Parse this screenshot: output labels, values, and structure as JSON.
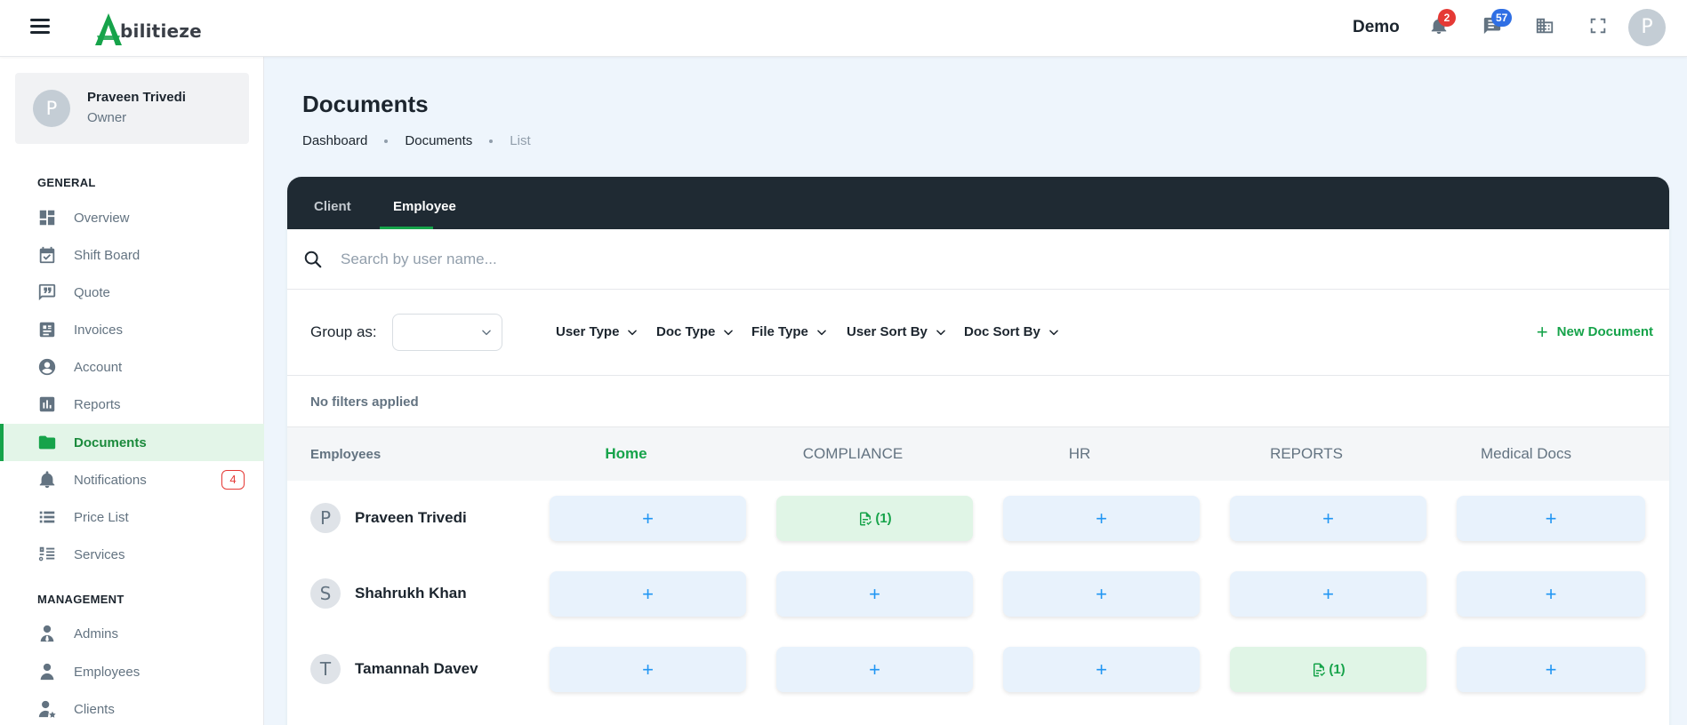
{
  "app": {
    "logo_letter": "A",
    "logo_text": "bilitieze",
    "company": "Demo",
    "notifications_count": "2",
    "messages_count": "57",
    "user_initial": "P",
    "colors": {
      "brand": "#16a34a",
      "notif_badge": "#e53935",
      "msg_badge": "#2f6fe4",
      "dark_tabbar": "#1f2a33"
    }
  },
  "sidebar": {
    "profile": {
      "initial": "P",
      "name": "Praveen Trivedi",
      "role": "Owner"
    },
    "general_title": "GENERAL",
    "general_items": [
      {
        "label": "Overview",
        "icon": "dashboard-icon"
      },
      {
        "label": "Shift Board",
        "icon": "calendar-check-icon"
      },
      {
        "label": "Quote",
        "icon": "quote-icon"
      },
      {
        "label": "Invoices",
        "icon": "invoice-icon"
      },
      {
        "label": "Account",
        "icon": "account-circle-icon"
      },
      {
        "label": "Reports",
        "icon": "bar-chart-icon"
      },
      {
        "label": "Documents",
        "icon": "folder-icon",
        "active": true
      },
      {
        "label": "Notifications",
        "icon": "bell-icon",
        "badge": "4"
      },
      {
        "label": "Price List",
        "icon": "list-icon"
      },
      {
        "label": "Services",
        "icon": "services-icon"
      }
    ],
    "management_title": "MANAGEMENT",
    "management_items": [
      {
        "label": "Admins",
        "icon": "admin-user-icon"
      },
      {
        "label": "Employees",
        "icon": "employee-user-icon"
      },
      {
        "label": "Clients",
        "icon": "client-star-icon"
      }
    ]
  },
  "page": {
    "title": "Documents",
    "breadcrumb": [
      "Dashboard",
      "Documents",
      "List"
    ]
  },
  "tabs": [
    {
      "label": "Client",
      "active": false
    },
    {
      "label": "Employee",
      "active": true
    }
  ],
  "search": {
    "placeholder": "Search by user name...",
    "value": ""
  },
  "filters": {
    "group_label": "Group as:",
    "group_value": "",
    "dropdowns": [
      "User Type",
      "Doc Type",
      "File Type",
      "User Sort By",
      "Doc Sort By"
    ],
    "new_document": "New Document",
    "status": "No filters applied"
  },
  "table": {
    "employee_header": "Employees",
    "columns": [
      "Home",
      "COMPLIANCE",
      "HR",
      "REPORTS",
      "Medical Docs"
    ],
    "active_column": "Home",
    "rows": [
      {
        "initial": "P",
        "name": "Praveen Trivedi",
        "cells": [
          "+",
          "(1)",
          "+",
          "+",
          "+"
        ]
      },
      {
        "initial": "S",
        "name": "Shahrukh Khan",
        "cells": [
          "+",
          "+",
          "+",
          "+",
          "+"
        ]
      },
      {
        "initial": "T",
        "name": "Tamannah Davev",
        "cells": [
          "+",
          "+",
          "+",
          "(1)",
          "+"
        ]
      }
    ]
  }
}
